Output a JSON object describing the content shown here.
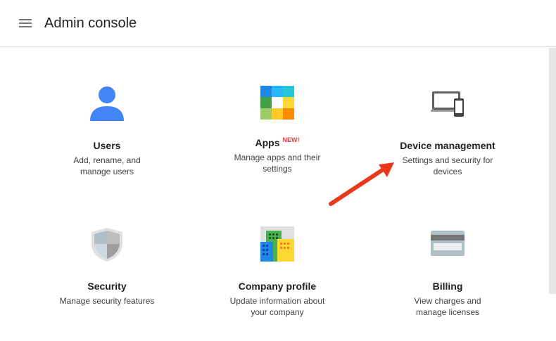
{
  "header": {
    "title": "Admin console",
    "menu_icon": "hamburger-menu-icon"
  },
  "tiles": [
    {
      "id": "users",
      "title": "Users",
      "description": "Add, rename, and manage users",
      "icon": "user-icon"
    },
    {
      "id": "apps",
      "title": "Apps",
      "badge": "NEW!",
      "description": "Manage apps and their settings",
      "icon": "apps-icon"
    },
    {
      "id": "device",
      "title": "Device management",
      "description": "Settings and security for devices",
      "icon": "devices-icon"
    },
    {
      "id": "security",
      "title": "Security",
      "description": "Manage security features",
      "icon": "shield-icon"
    },
    {
      "id": "company",
      "title": "Company profile",
      "description": "Update information about your company",
      "icon": "buildings-icon"
    },
    {
      "id": "billing",
      "title": "Billing",
      "description": "View charges and manage licenses",
      "icon": "credit-card-icon"
    }
  ],
  "colors": {
    "accent_blue": "#4285f4",
    "badge_red": "#e53935",
    "arrow_red": "#e8391d"
  }
}
